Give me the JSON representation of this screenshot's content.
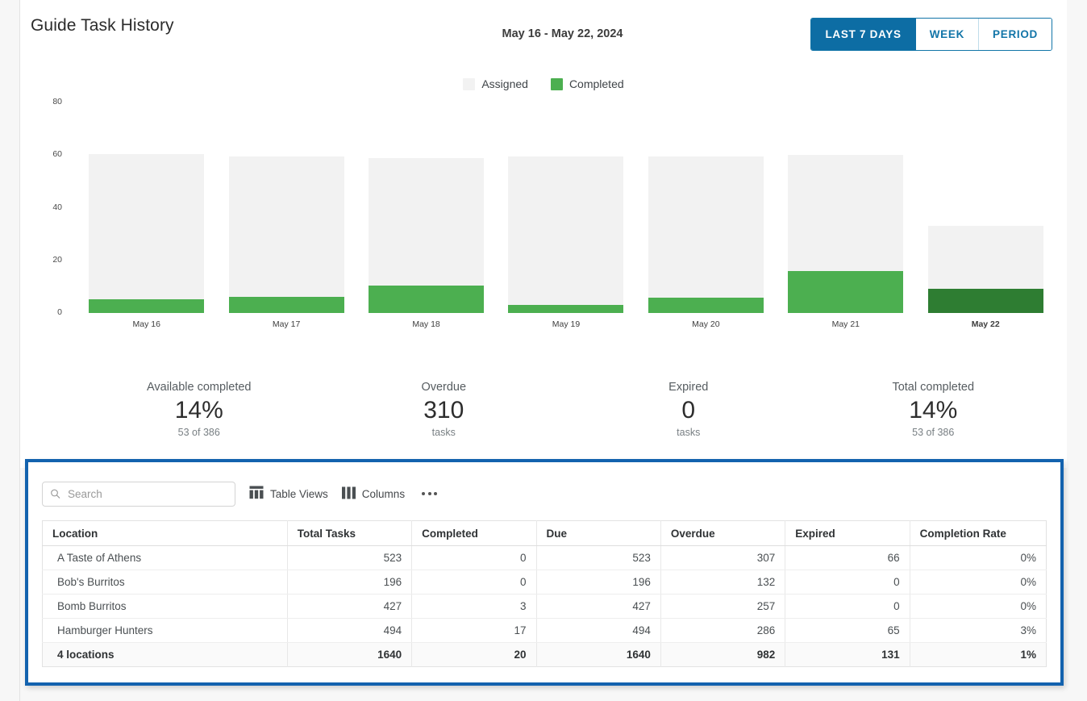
{
  "header": {
    "title": "Guide Task History",
    "date_range": "May 16 - May 22, 2024",
    "range_buttons": [
      {
        "label": "LAST 7 DAYS",
        "active": true
      },
      {
        "label": "WEEK",
        "active": false
      },
      {
        "label": "PERIOD",
        "active": false
      }
    ]
  },
  "colors": {
    "accent_blue": "#0d6da4",
    "highlight_blue": "#1362ae",
    "assigned_gray": "#f2f2f2",
    "completed_green": "#4caf50",
    "completed_green_today": "#2e7d32"
  },
  "legend": [
    {
      "label": "Assigned",
      "color": "#f2f2f2"
    },
    {
      "label": "Completed",
      "color": "#4caf50"
    }
  ],
  "chart_data": {
    "type": "bar",
    "title": "Guide Task History",
    "subtitle": "May 16 - May 22, 2024",
    "stacked": false,
    "overlay": true,
    "xlabel": "",
    "ylabel": "",
    "ylim": [
      0,
      80
    ],
    "yticks": [
      0,
      20,
      40,
      60,
      80
    ],
    "grid": false,
    "legend_position": "top-center",
    "categories": [
      "May 16",
      "May 17",
      "May 18",
      "May 19",
      "May 20",
      "May 21",
      "May 22"
    ],
    "today_index": 6,
    "series": [
      {
        "name": "Assigned",
        "color": "#f2f2f2",
        "values": [
          58.5,
          57.6,
          57.0,
          57.6,
          57.6,
          58.2,
          32.0
        ]
      },
      {
        "name": "Completed",
        "color": "#4caf50",
        "values": [
          4.9,
          5.8,
          10.1,
          3.1,
          5.5,
          15.3,
          8.9
        ]
      }
    ]
  },
  "stats": [
    {
      "label": "Available completed",
      "value": "14%",
      "sub": "53 of 386"
    },
    {
      "label": "Overdue",
      "value": "310",
      "sub": "tasks"
    },
    {
      "label": "Expired",
      "value": "0",
      "sub": "tasks"
    },
    {
      "label": "Total completed",
      "value": "14%",
      "sub": "53 of 386"
    }
  ],
  "toolbar": {
    "search_placeholder": "Search",
    "search_value": "",
    "table_views_label": "Table Views",
    "columns_label": "Columns",
    "more_label": "More options"
  },
  "table": {
    "columns": [
      "Location",
      "Total Tasks",
      "Completed",
      "Due",
      "Overdue",
      "Expired",
      "Completion Rate"
    ],
    "rows": [
      {
        "location": "A Taste of Athens",
        "total_tasks": "523",
        "completed": "0",
        "due": "523",
        "overdue": "307",
        "expired": "66",
        "completion_rate": "0%"
      },
      {
        "location": "Bob's Burritos",
        "total_tasks": "196",
        "completed": "0",
        "due": "196",
        "overdue": "132",
        "expired": "0",
        "completion_rate": "0%"
      },
      {
        "location": "Bomb Burritos",
        "total_tasks": "427",
        "completed": "3",
        "due": "427",
        "overdue": "257",
        "expired": "0",
        "completion_rate": "0%"
      },
      {
        "location": "Hamburger Hunters",
        "total_tasks": "494",
        "completed": "17",
        "due": "494",
        "overdue": "286",
        "expired": "65",
        "completion_rate": "3%"
      }
    ],
    "total_row": {
      "location": "4 locations",
      "total_tasks": "1640",
      "completed": "20",
      "due": "1640",
      "overdue": "982",
      "expired": "131",
      "completion_rate": "1%"
    }
  }
}
